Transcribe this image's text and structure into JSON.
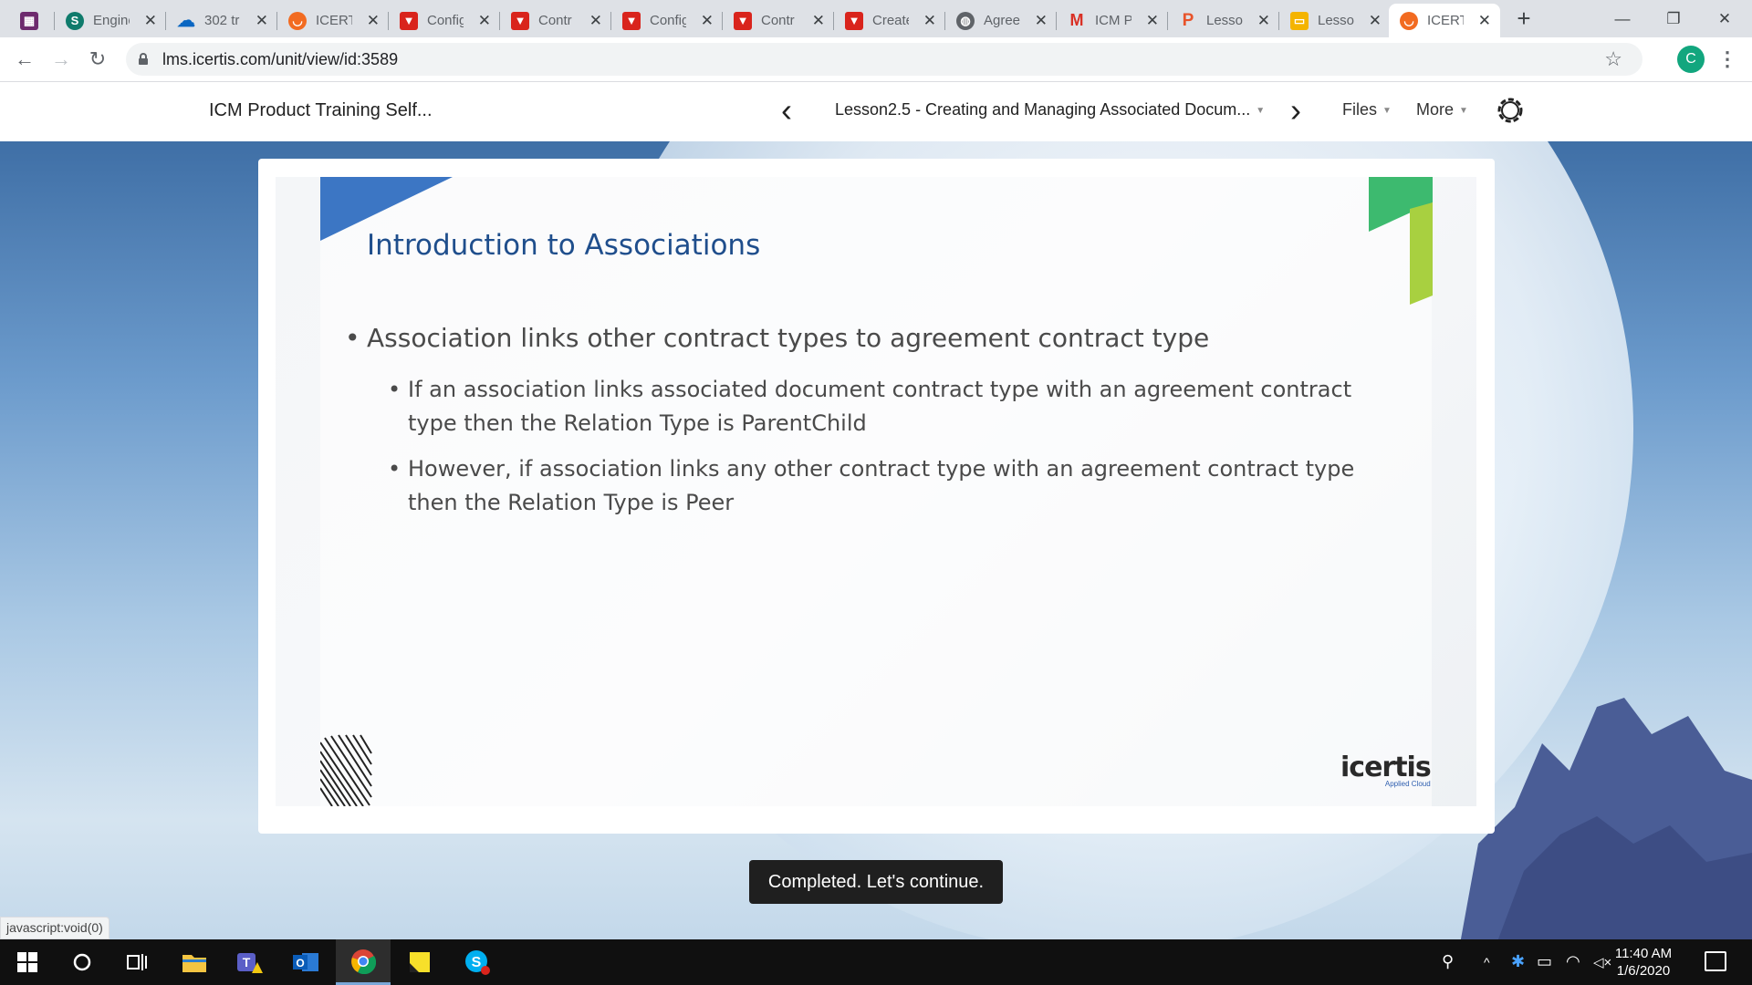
{
  "browser": {
    "tabs": [
      {
        "title": "",
        "icon": "app-grid-icon",
        "color": "#6e2a6e"
      },
      {
        "title": "Engine",
        "icon": "sharepoint-icon",
        "color": "#0f7b6c"
      },
      {
        "title": "302 tr",
        "icon": "onedrive-icon",
        "color": "#0a66c2"
      },
      {
        "title": "ICERT",
        "icon": "icertis-icon",
        "color": "#f26b21"
      },
      {
        "title": "Config",
        "icon": "red-flag-icon",
        "color": "#d9241c"
      },
      {
        "title": "Contr",
        "icon": "red-flag-icon",
        "color": "#d9241c"
      },
      {
        "title": "Config",
        "icon": "red-flag-icon",
        "color": "#d9241c"
      },
      {
        "title": "Contr",
        "icon": "red-flag-icon",
        "color": "#d9241c"
      },
      {
        "title": "Create",
        "icon": "red-flag-icon",
        "color": "#d9241c"
      },
      {
        "title": "Agree",
        "icon": "globe-icon",
        "color": "#5f6368"
      },
      {
        "title": "ICM P",
        "icon": "gmail-icon",
        "color": "#d93025"
      },
      {
        "title": "Lessor",
        "icon": "p-letter-icon",
        "color": "#e8532a"
      },
      {
        "title": "Lessor",
        "icon": "slides-icon",
        "color": "#f4b400"
      },
      {
        "title": "ICERT",
        "icon": "icertis-icon",
        "color": "#f26b21",
        "active": true
      }
    ],
    "url": "lms.icertis.com/unit/view/id:3589",
    "profile_initial": "C"
  },
  "lms": {
    "course_title": "ICM Product Training Self...",
    "lesson_title": "Lesson2.5 - Creating and Managing Associated Docum...",
    "files_label": "Files",
    "more_label": "More"
  },
  "slide": {
    "title": "Introduction to Associations",
    "bullet1": "Association links other contract types to agreement contract type",
    "bullet2": "If an association links associated document contract type with an agreement contract type then the Relation Type is ParentChild",
    "bullet3": "However, if association links any other contract type with an agreement contract type then the Relation Type is Peer",
    "brand": "icertis",
    "brand_tag": "Applied Cloud"
  },
  "continue_button": "Completed. Let's continue.",
  "status_link": "javascript:void(0)",
  "taskbar": {
    "time": "11:40 AM",
    "date": "1/6/2020"
  }
}
